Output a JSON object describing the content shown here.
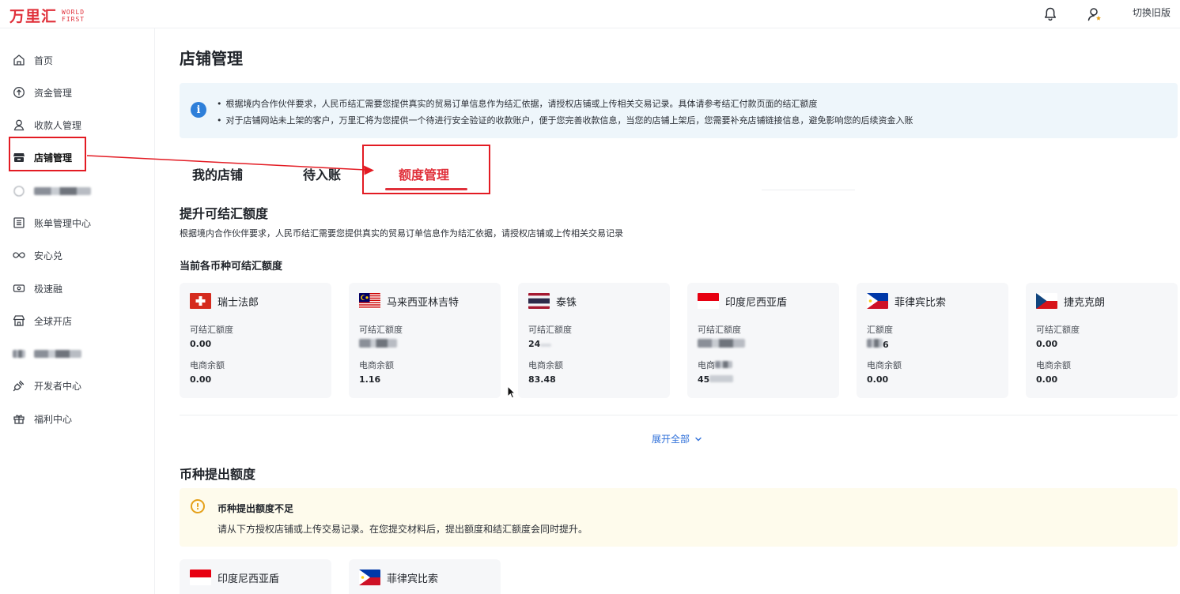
{
  "header": {
    "logo_cn": "万里汇",
    "logo_en_line1": "WORLD",
    "logo_en_line2": "FIRST",
    "switch_version": "切换旧版",
    "icons": [
      "bell-icon",
      "user-icon"
    ]
  },
  "sidebar": {
    "items": [
      {
        "label": "首页",
        "icon": "home-icon"
      },
      {
        "label": "资金管理",
        "icon": "upload-circle-icon"
      },
      {
        "label": "收款人管理",
        "icon": "person-icon"
      },
      {
        "label": "店铺管理",
        "icon": "store-icon",
        "active": true
      },
      {
        "label": "",
        "icon": "blurred-icon",
        "blurred": true
      },
      {
        "label": "账单管理中心",
        "icon": "list-icon"
      },
      {
        "label": "安心兑",
        "icon": "infinity-icon"
      },
      {
        "label": "极速融",
        "icon": "money-icon"
      },
      {
        "label": "全球开店",
        "icon": "shop-icon"
      },
      {
        "label": "",
        "icon": "blurred-icon",
        "blurred": true
      },
      {
        "label": "开发者中心",
        "icon": "plug-icon"
      },
      {
        "label": "福利中心",
        "icon": "gift-icon"
      }
    ]
  },
  "main": {
    "title": "店铺管理",
    "notice": {
      "line1": "根据境内合作伙伴要求，人民币结汇需要您提供真实的贸易订单信息作为结汇依据，请授权店铺或上传相关交易记录。具体请参考结汇付款页面的结汇额度",
      "line2": "对于店铺网站未上架的客户，万里汇将为您提供一个待进行安全验证的收款账户，便于您完善收款信息，当您的店铺上架后，您需要补充店铺链接信息，避免影响您的后续资金入账"
    },
    "tabs": [
      {
        "label": "我的店铺"
      },
      {
        "label": "待入账"
      },
      {
        "label": "额度管理",
        "active": true
      }
    ],
    "section1": {
      "title": "提升可结汇额度",
      "desc": "根据境内合作伙伴要求，人民币结汇需要您提供真实的贸易订单信息作为结汇依据，请授权店铺或上传相关交易记录",
      "subtitle": "当前各币种可结汇额度"
    },
    "cards": [
      {
        "currency": "瑞士法郎",
        "flag": "ch",
        "label1": "可结汇额度",
        "value1": "0.00",
        "label2": "电商余额",
        "value2": "0.00"
      },
      {
        "currency": "马来西亚林吉特",
        "flag": "my",
        "label1": "可结汇额度",
        "value1": "",
        "label2": "电商余额",
        "value2": "1.16"
      },
      {
        "currency": "泰铢",
        "flag": "th",
        "label1": "可结汇额度",
        "value1": "24",
        "label2": "电商余额",
        "value2": "83.48"
      },
      {
        "currency": "印度尼西亚盾",
        "flag": "id",
        "label1": "可结汇额度",
        "value1": "",
        "label2": "电商",
        "value2": "45"
      },
      {
        "currency": "菲律宾比索",
        "flag": "ph",
        "label1": "汇额度",
        "value1": "6",
        "label2": "电商余额",
        "value2": "0.00"
      },
      {
        "currency": "捷克克朗",
        "flag": "cz",
        "label1": "可结汇额度",
        "value1": "0.00",
        "label2": "电商余额",
        "value2": "0.00"
      }
    ],
    "expand_all": "展开全部",
    "section2": {
      "title": "币种提出额度",
      "warn_title": "币种提出额度不足",
      "warn_text": "请从下方授权店铺或上传交易记录。在您提交材料后，提出额度和结汇额度会同时提升。"
    },
    "cards2": [
      {
        "currency": "印度尼西亚盾",
        "flag": "id"
      },
      {
        "currency": "菲律宾比索",
        "flag": "ph"
      }
    ]
  },
  "colors": {
    "brand_red": "#e0303a",
    "annotation_red": "#e31b23",
    "link_blue": "#2e6fd9",
    "info_blue": "#2e7fd9",
    "warn_orange": "#e5a019"
  }
}
